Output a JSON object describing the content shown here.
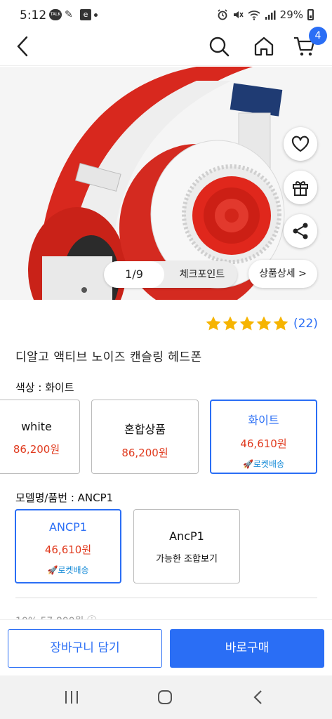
{
  "status_bar": {
    "time": "5:12",
    "notifications": [
      "TALK",
      "✎",
      "e"
    ],
    "battery": "29%"
  },
  "header": {
    "cart_badge": "4"
  },
  "hero": {
    "pager_count": "1/9",
    "checkpoint_label": "체크포인트",
    "detail_label": "상품상세 >"
  },
  "rating": {
    "stars": 5,
    "count": "(22)"
  },
  "product": {
    "title": "디알고 액티브 노이즈 캔슬링 헤드폰"
  },
  "color_option": {
    "label": "색상 : 화이트",
    "choices": [
      {
        "name": "white",
        "price": "86,200원",
        "selected": false
      },
      {
        "name": "혼합상품",
        "price": "86,200원",
        "selected": false
      },
      {
        "name": "화이트",
        "price": "46,610원",
        "badge": "🚀로켓배송",
        "selected": true
      }
    ]
  },
  "model_option": {
    "label": "모델명/품번 : ANCP1",
    "choices": [
      {
        "name": "ANCP1",
        "price": "46,610원",
        "badge": "🚀로켓배송",
        "selected": true
      },
      {
        "name": "AncP1",
        "sub": "가능한 조합보기",
        "selected": false
      }
    ]
  },
  "peek_text": "10%  57,800원 ⓘ",
  "bottom": {
    "cart_button": "장바구니 담기",
    "buy_button": "바로구매"
  },
  "colors": {
    "accent": "#2a6ef5",
    "price_red": "#e03a1e",
    "rocket_blue": "#1a8dd8",
    "headphone_red": "#d8281e"
  }
}
